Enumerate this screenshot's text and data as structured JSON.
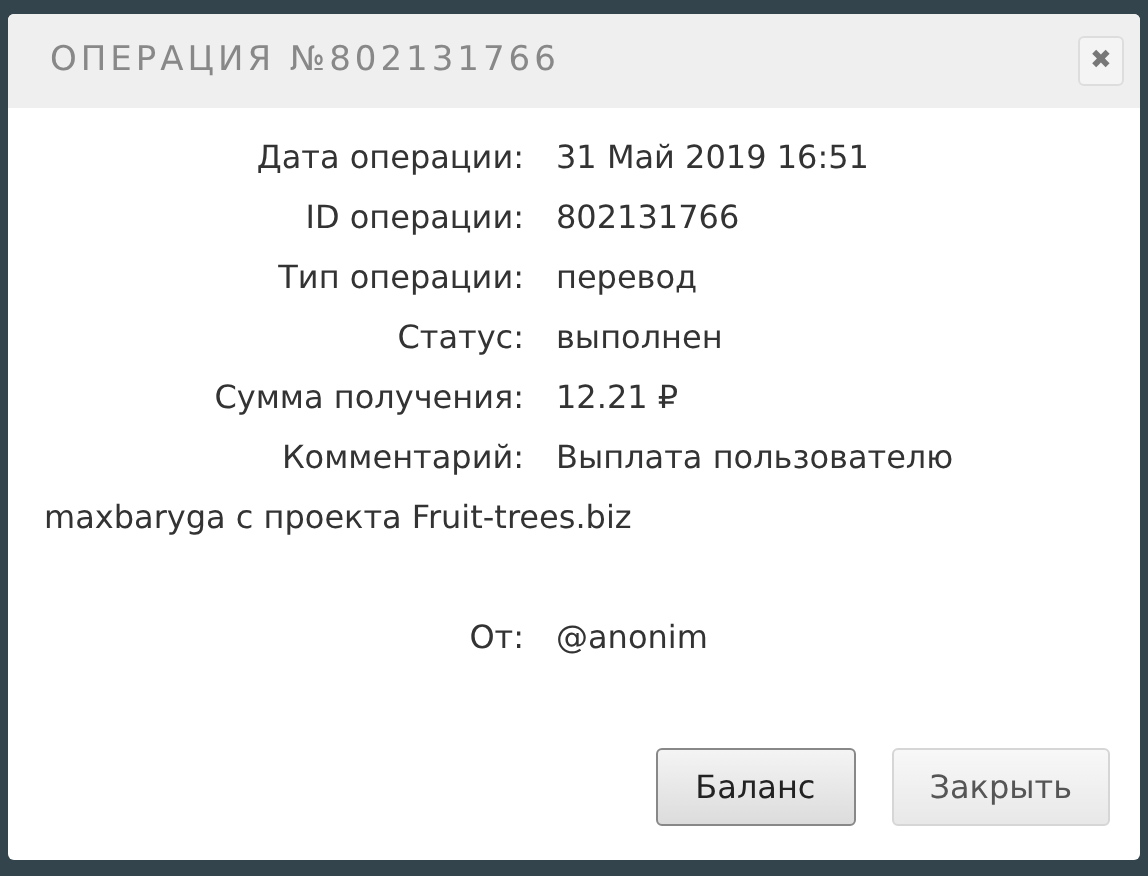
{
  "dialog": {
    "title": "ОПЕРАЦИЯ №802131766",
    "close_icon": "✖"
  },
  "fields": [
    {
      "label": "Дата операции:",
      "value": "31 Май 2019 16:51"
    },
    {
      "label": "ID операции:",
      "value": "802131766"
    },
    {
      "label": "Тип операции:",
      "value": "перевод"
    },
    {
      "label": "Статус:",
      "value": "выполнен"
    },
    {
      "label": "Сумма получения:",
      "value": "12.21 ₽"
    },
    {
      "label": "Комментарий:",
      "value": "Выплата пользователю maxbaryga с проекта Fruit-trees.biz"
    }
  ],
  "from": {
    "label": "От:",
    "value": "@anonim"
  },
  "buttons": [
    {
      "label": "Баланс",
      "selected": true
    },
    {
      "label": "Закрыть",
      "selected": false
    }
  ]
}
